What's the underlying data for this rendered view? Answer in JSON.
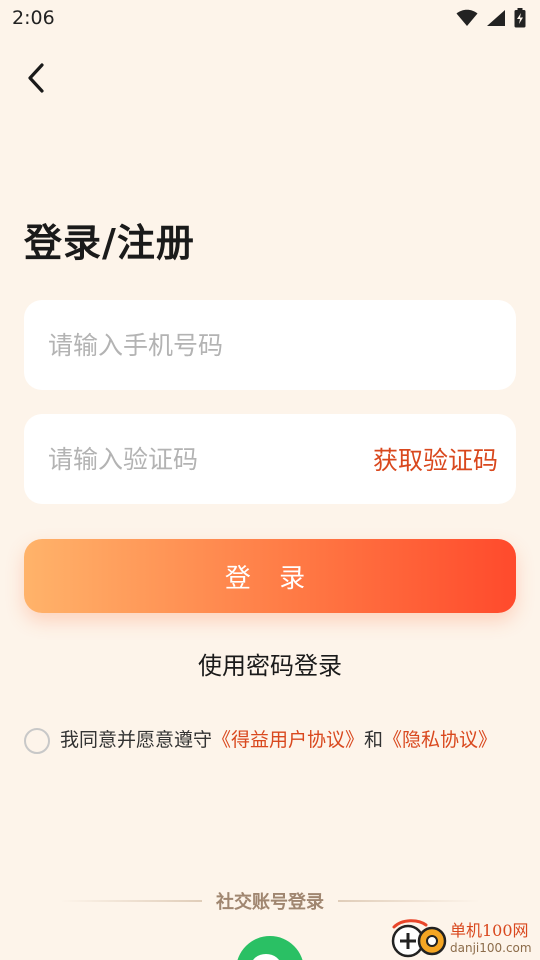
{
  "status_bar": {
    "time": "2:06",
    "icons": [
      "wifi-icon",
      "signal-icon",
      "battery-icon"
    ]
  },
  "header": {
    "back_icon": "chevron-left-icon"
  },
  "title": "登录/注册",
  "phone_input": {
    "value": "",
    "placeholder": "请输入手机号码"
  },
  "code_input": {
    "value": "",
    "placeholder": "请输入验证码",
    "get_code_label": "获取验证码"
  },
  "login_button": "登 录",
  "password_login_link": "使用密码登录",
  "agreement": {
    "checked": false,
    "prefix": "我同意并愿意遵守",
    "user_agreement": "《得益用户协议》",
    "and": "和",
    "privacy_policy": "《隐私协议》"
  },
  "social_login": {
    "label": "社交账号登录",
    "providers": [
      "wechat-icon"
    ]
  },
  "watermark": {
    "cn": "单机100网",
    "en": "danji100.com"
  },
  "colors": {
    "background": "#fdf4ea",
    "accent": "#d9481e",
    "button_gradient_start": "#ffb36a",
    "button_gradient_end": "#ff4a2c",
    "wechat": "#2ac064"
  }
}
